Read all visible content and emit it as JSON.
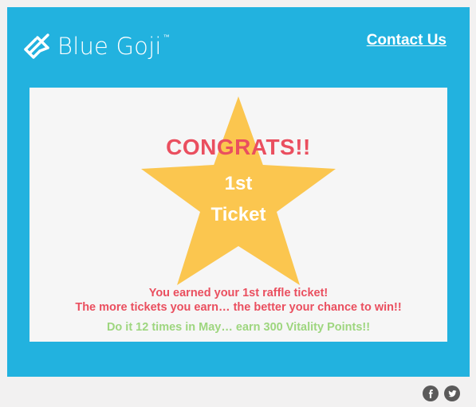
{
  "header": {
    "brand_name": "Blue Goji",
    "brand_mark": "™",
    "contact_label": "Contact Us"
  },
  "hero": {
    "headline": "CONGRATS!!",
    "star_line_1": "1st",
    "star_line_2": "Ticket",
    "message_line_1": "You earned your 1st raffle ticket!",
    "message_line_2": "The more tickets you earn… the better your chance to win!!",
    "message_line_3": "Do it 12 times in May… earn 300 Vitality Points!!"
  },
  "footer": {
    "social_icons": [
      "facebook-icon",
      "twitter-icon"
    ]
  },
  "colors": {
    "page_background": "#f2f1f1",
    "brand_blue": "#22b2df",
    "card_background": "#f6f6f6",
    "star_yellow": "#fbc64f",
    "headline_red": "#ea4f5f",
    "success_green": "#9ed67f",
    "social_gray": "#5b5a5a"
  }
}
